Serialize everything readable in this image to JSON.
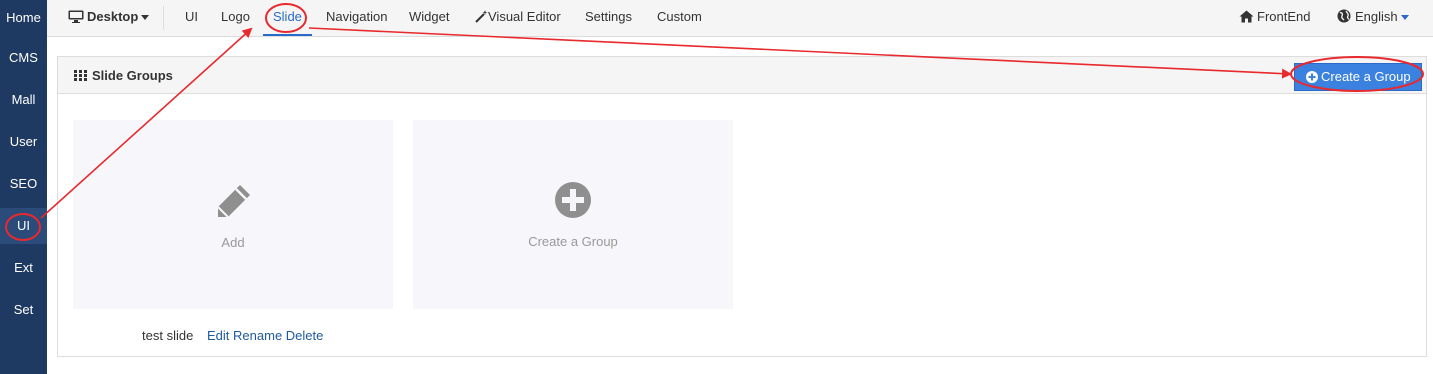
{
  "sidebar": {
    "items": [
      {
        "label": "Home"
      },
      {
        "label": "CMS"
      },
      {
        "label": "Mall"
      },
      {
        "label": "User"
      },
      {
        "label": "SEO"
      },
      {
        "label": "UI"
      },
      {
        "label": "Ext"
      },
      {
        "label": "Set"
      }
    ],
    "active": "UI"
  },
  "topnav": {
    "desktop_label": "Desktop",
    "items": [
      {
        "label": "UI"
      },
      {
        "label": "Logo"
      },
      {
        "label": "Slide"
      },
      {
        "label": "Navigation"
      },
      {
        "label": "Widget"
      },
      {
        "label": "Visual Editor"
      },
      {
        "label": "Settings"
      },
      {
        "label": "Custom"
      }
    ],
    "active": "Slide",
    "frontend_label": "FrontEnd",
    "language_label": "English"
  },
  "panel": {
    "title": "Slide Groups",
    "create_button_label": "Create a Group"
  },
  "cards": [
    {
      "label": "Add",
      "icon": "pencil-icon"
    },
    {
      "label": "Create a Group",
      "icon": "plus-circle-icon"
    }
  ],
  "slide": {
    "name": "test slide",
    "actions": [
      "Edit",
      "Rename",
      "Delete"
    ]
  },
  "colors": {
    "sidebar_bg": "#1f3a62",
    "accent": "#2a6bc9",
    "button_bg": "#3b82e0",
    "annotation_red": "#e8292d"
  }
}
